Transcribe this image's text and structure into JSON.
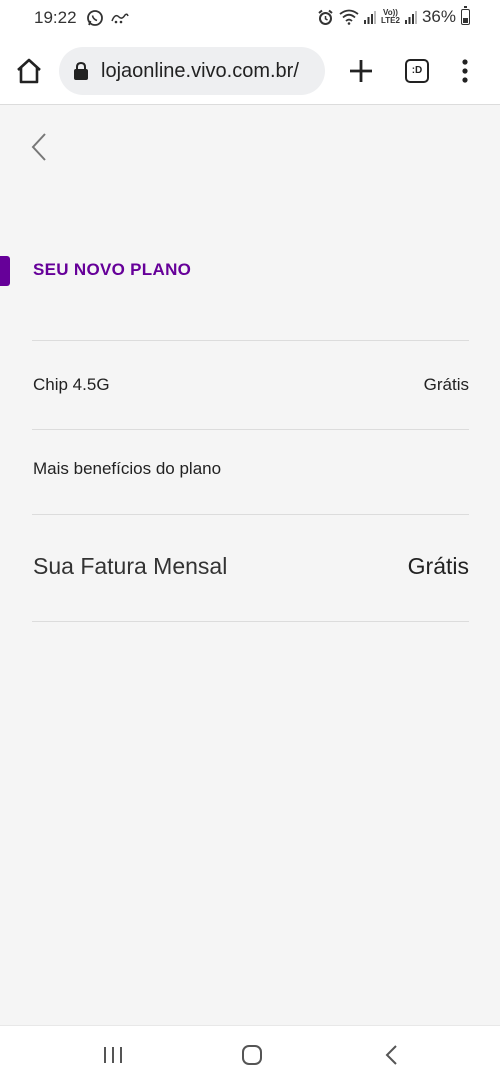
{
  "status_bar": {
    "time": "19:22",
    "battery": "36%",
    "network_badge_top": "Vo))",
    "network_badge_bottom": "LTE2",
    "icons": [
      "whatsapp-icon",
      "app-notification-icon",
      "alarm-icon",
      "wifi-icon",
      "signal-icon",
      "lte-badge",
      "signal-icon",
      "battery-icon"
    ]
  },
  "browser": {
    "url": "lojaonline.vivo.com.br/",
    "tabs_label": ":D",
    "icons": [
      "home-icon",
      "lock-icon",
      "plus-icon",
      "tabs-icon",
      "menu-icon"
    ]
  },
  "plan": {
    "section_title": "SEU NOVO PLANO",
    "items": [
      {
        "label": "Chip 4.5G",
        "value": "Grátis"
      },
      {
        "label": "Mais benefícios do plano",
        "value": ""
      }
    ],
    "total": {
      "label": "Sua Fatura Mensal",
      "value": "Grátis"
    }
  },
  "colors": {
    "accent": "#660099",
    "background": "#f5f5f5",
    "divider": "#dcdcdc"
  },
  "nav": {
    "icons": [
      "recent-apps-icon",
      "home-button-icon",
      "back-nav-icon"
    ]
  }
}
